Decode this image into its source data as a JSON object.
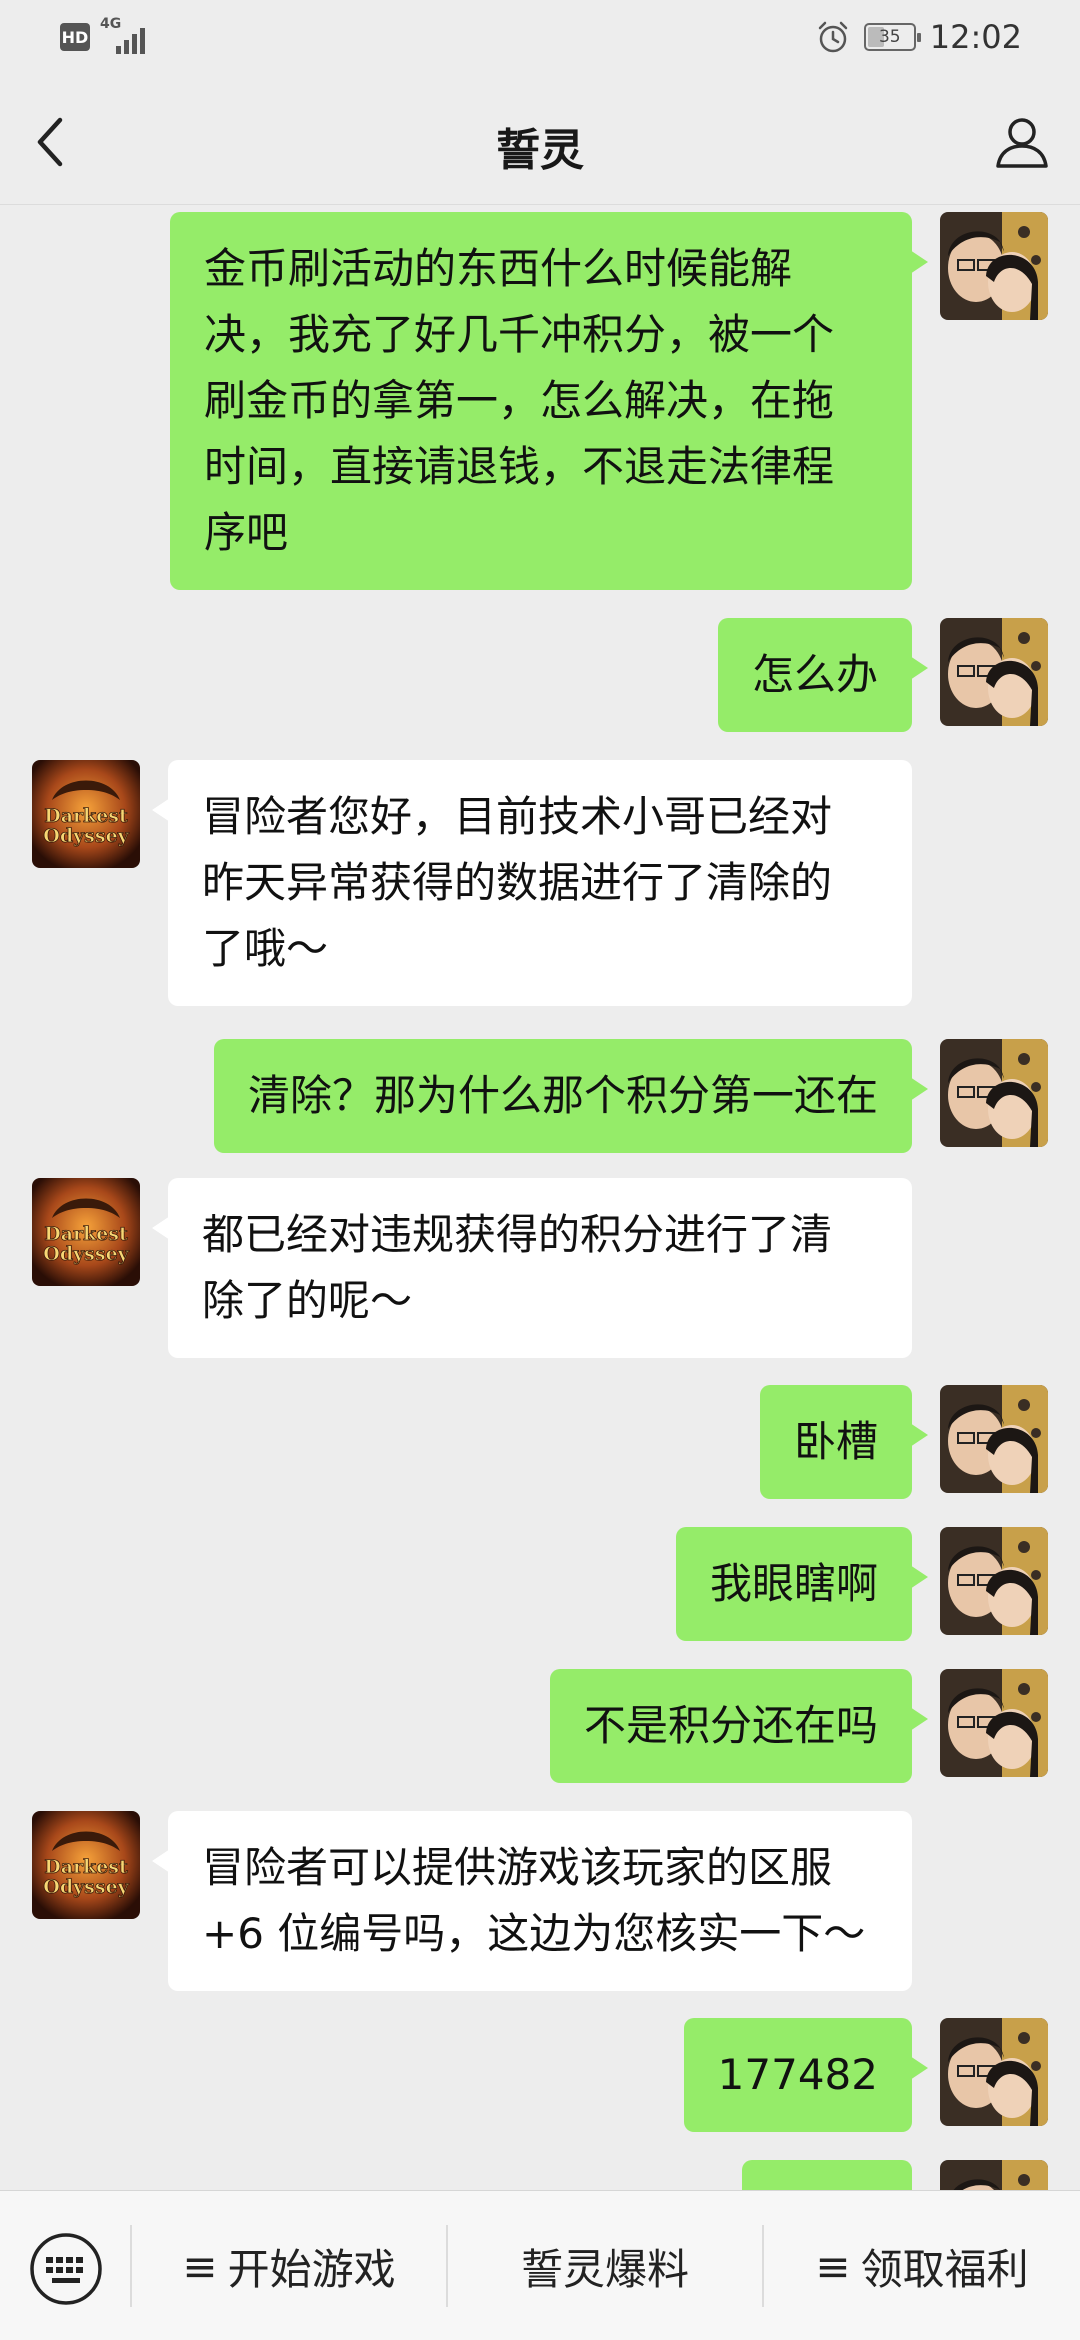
{
  "status_bar": {
    "hd_label": "HD",
    "network_label": "4G",
    "battery_level": "35",
    "time": "12:02"
  },
  "header": {
    "title": "誓灵",
    "back_icon": "chevron-left-icon",
    "profile_icon": "person-icon"
  },
  "messages": [
    {
      "side": "sent",
      "text": "金币刷活动的东西什么时候能解\n决，我充了好几千冲积分，被一个\n刷金币的拿第一，怎么解决，在拖\n时间，直接请退钱，不退走法律程\n序吧"
    },
    {
      "side": "sent",
      "text": "怎么办"
    },
    {
      "side": "recv",
      "text": "冒险者您好，目前技术小哥已经对\n昨天异常获得的数据进行了清除的\n了哦～"
    },
    {
      "side": "sent",
      "text": "清除？那为什么那个积分第一还在"
    },
    {
      "side": "recv",
      "text": "都已经对违规获得的积分进行了清\n除了的呢～"
    },
    {
      "side": "sent",
      "text": "卧槽"
    },
    {
      "side": "sent",
      "text": "我眼瞎啊"
    },
    {
      "side": "sent",
      "text": "不是积分还在吗"
    },
    {
      "side": "recv",
      "text": "冒险者可以提供游戏该玩家的区服\n+6 位编号吗，这边为您核实一下～"
    },
    {
      "side": "sent",
      "text": "177482"
    },
    {
      "side": "sent",
      "text": ""
    }
  ],
  "game_avatar": {
    "line1": "Darkest",
    "line2": "Odyssey"
  },
  "bottom_menu": {
    "keyboard_icon": "keyboard-icon",
    "items": [
      {
        "prefix": "≡",
        "label": "开始游戏"
      },
      {
        "prefix": "",
        "label": "誓灵爆料"
      },
      {
        "prefix": "≡",
        "label": "领取福利"
      }
    ]
  }
}
